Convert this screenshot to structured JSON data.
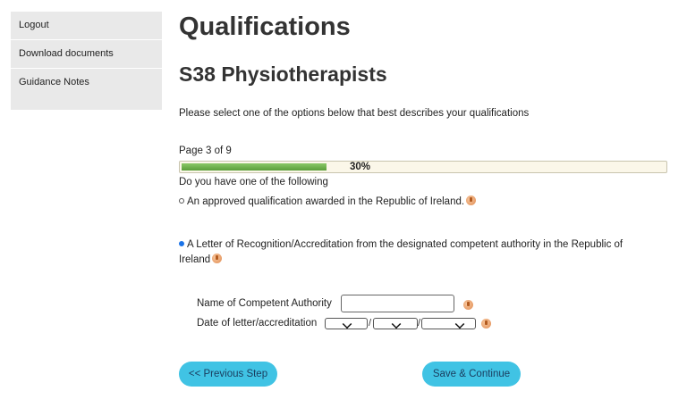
{
  "sidebar": {
    "items": [
      {
        "label": "Logout"
      },
      {
        "label": "Download documents"
      },
      {
        "label": "Guidance Notes"
      }
    ]
  },
  "main": {
    "title": "Qualifications",
    "subtitle": "S38 Physiotherapists",
    "intro": "Please select one of the options below that best describes your qualifications",
    "page_indicator": "Page 3 of 9",
    "progress": {
      "percent": 30,
      "label": "30%",
      "bar_color": "#6ab04c"
    },
    "question": "Do you have one of the following",
    "options": [
      {
        "label": "An approved qualification awarded in the Republic of Ireland.",
        "selected": false
      },
      {
        "label": "A Letter of Recognition/Accreditation from the designated competent authority in the Republic of Ireland",
        "selected": true
      }
    ],
    "fields": {
      "authority_label": "Name of Competent Authority",
      "authority_value": "",
      "date_label": "Date of letter/accreditation",
      "date_separator": "/"
    },
    "buttons": {
      "previous": "<< Previous Step",
      "save": "Save & Continue"
    }
  },
  "icons": {
    "help": "help-icon",
    "dropdown": "chevron-down-icon"
  },
  "colors": {
    "button": "#40c3e4",
    "radio_selected": "#1a73e8",
    "sidebar_bg": "#e9e9e9"
  }
}
